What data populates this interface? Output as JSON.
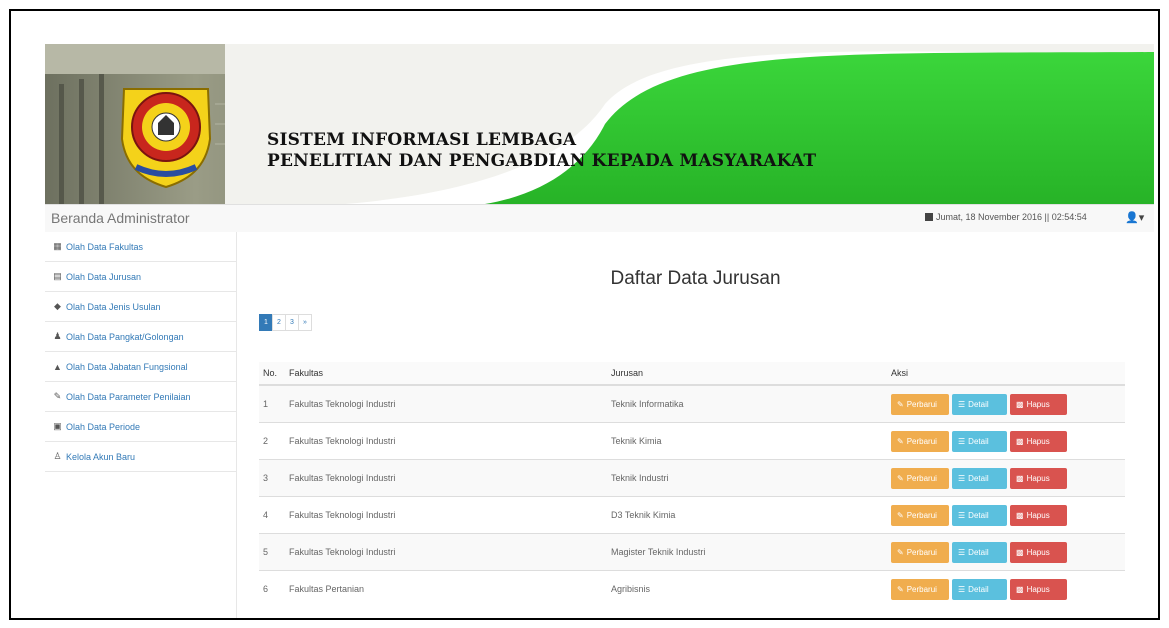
{
  "banner": {
    "title_line1": "SISTEM INFORMASI LEMBAGA",
    "title_line2": "PENELITIAN DAN PENGABDIAN KEPADA MASYARAKAT"
  },
  "topbar": {
    "brand": "Beranda Administrator",
    "datetime": "Jumat, 18 November 2016 || 02:54:54"
  },
  "sidebar": {
    "items": [
      {
        "label": "Olah Data Fakultas",
        "icon": "building-icon"
      },
      {
        "label": "Olah Data Jurusan",
        "icon": "list-icon"
      },
      {
        "label": "Olah Data Jenis Usulan",
        "icon": "tag-icon"
      },
      {
        "label": "Olah Data Pangkat/Golongan",
        "icon": "users-icon"
      },
      {
        "label": "Olah Data Jabatan Fungsional",
        "icon": "graduation-cap-icon"
      },
      {
        "label": "Olah Data Parameter Penilaian",
        "icon": "pencil-icon"
      },
      {
        "label": "Olah Data Periode",
        "icon": "calendar-icon"
      },
      {
        "label": "Kelola Akun Baru",
        "icon": "user-icon"
      }
    ]
  },
  "main": {
    "title": "Daftar Data Jurusan",
    "pagination": [
      "1",
      "2",
      "3",
      "»"
    ],
    "table": {
      "headers": [
        "No.",
        "Fakultas",
        "Jurusan",
        "Aksi"
      ],
      "actions": {
        "edit": "Perbarui",
        "detail": "Detail",
        "delete": "Hapus"
      },
      "rows": [
        {
          "no": "1",
          "fakultas": "Fakultas Teknologi Industri",
          "jurusan": "Teknik Informatika"
        },
        {
          "no": "2",
          "fakultas": "Fakultas Teknologi Industri",
          "jurusan": "Teknik Kimia"
        },
        {
          "no": "3",
          "fakultas": "Fakultas Teknologi Industri",
          "jurusan": "Teknik Industri"
        },
        {
          "no": "4",
          "fakultas": "Fakultas Teknologi Industri",
          "jurusan": "D3 Teknik Kimia"
        },
        {
          "no": "5",
          "fakultas": "Fakultas Teknologi Industri",
          "jurusan": "Magister Teknik Industri"
        },
        {
          "no": "6",
          "fakultas": "Fakultas Pertanian",
          "jurusan": "Agribisnis"
        }
      ]
    }
  },
  "colors": {
    "banner_green": "#2fc42f",
    "primary": "#337ab7",
    "warning": "#f0ad4e",
    "info": "#5bc0de",
    "danger": "#d9534f"
  }
}
